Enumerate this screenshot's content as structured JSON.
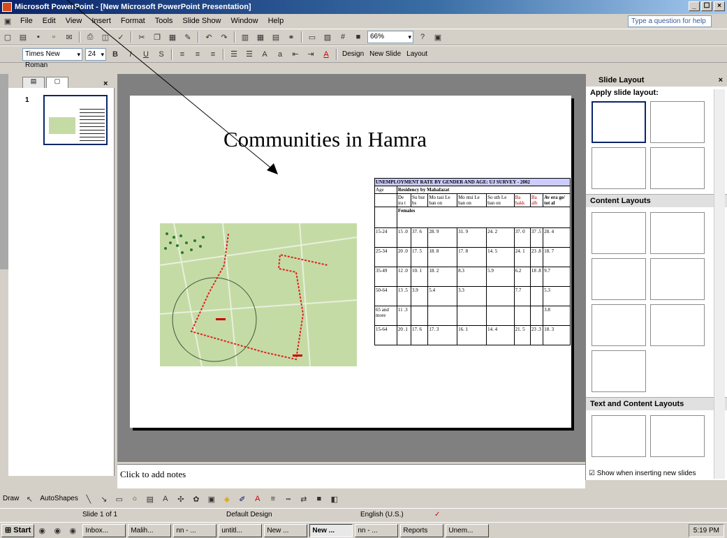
{
  "window": {
    "title": "Microsoft PowerPoint - [New Microsoft PowerPoint Presentation]",
    "minimize": "_",
    "maximize": "☐",
    "close": "×"
  },
  "menu": [
    "File",
    "Edit",
    "View",
    "Insert",
    "Format",
    "Tools",
    "Slide Show",
    "Window",
    "Help"
  ],
  "help_box": "Type a question for help",
  "format": {
    "font": "Times New Roman",
    "size": "24",
    "zoom": "66%",
    "design": "Design",
    "new_slide": "New Slide",
    "layout": "Layout"
  },
  "thumb": {
    "number": "1"
  },
  "slide": {
    "title": "Communities in Hamra"
  },
  "table": {
    "heading": "UNEMPLOYMENT RATE BY GENDER AND AGE: UJ SURVEY - 2002",
    "age": "Age",
    "residency": "Residency by Mahafazat",
    "cols": [
      "De ira t",
      "Su bur bs",
      "Mo tasi Le ban on",
      "Mo ntsi Le ban on",
      "So uth Le ban on",
      "Ba bakk",
      "Ba alb",
      "Av era ge/ tot al"
    ],
    "females": "Females",
    "rows": [
      [
        "15-24",
        "15 .0",
        "37. 6",
        "28. 9",
        "31. 9",
        "24. 2",
        "37. 0",
        "37 .5",
        "28. 4"
      ],
      [
        "25-34",
        "20 .0",
        "17. 5",
        "18. 8",
        "17. 8",
        "14. 5",
        "24. 1",
        "23 .8",
        "18. 7"
      ],
      [
        "35-49",
        "12 .0",
        "10. 1",
        "18. 2",
        "8.3",
        "5.9",
        "6.2",
        "18 .8",
        "9.7"
      ],
      [
        "50-64",
        "13 .5",
        "3.9",
        "5.4",
        "3.3",
        "",
        "7.7",
        "",
        "5.3"
      ],
      [
        "65 and more",
        "11 .3",
        "",
        "",
        "",
        "",
        "",
        "",
        "3.8"
      ],
      [
        "15-64",
        "20 .1",
        "17. 6",
        "17. 3",
        "16. 1",
        "14. 4",
        "21. 5",
        "23 .3",
        "18. 3"
      ]
    ]
  },
  "notes": "Click to add notes",
  "taskpane": {
    "title": "Slide Layout",
    "apply": "Apply slide layout:",
    "content": "Content Layouts",
    "text_content": "Text and Content Layouts",
    "show": "Show when inserting new slides"
  },
  "drawbar": {
    "draw": "Draw",
    "autoshapes": "AutoShapes"
  },
  "status": {
    "slide": "Slide 1 of 1",
    "design": "Default Design",
    "lang": "English (U.S.)"
  },
  "taskbar": {
    "start": "Start",
    "items": [
      "Inbox...",
      "Malih...",
      "nn - ...",
      "untitl...",
      "New ...",
      "New ...",
      "nn - ...",
      "Reports",
      "Unem..."
    ],
    "clock": "5:19 PM"
  }
}
